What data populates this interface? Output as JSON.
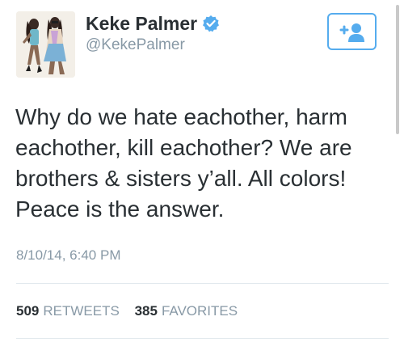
{
  "user": {
    "display_name": "Keke Palmer",
    "handle": "@KekePalmer",
    "verified": true
  },
  "follow_button": {
    "icon": "add-user-icon",
    "color": "#55acee"
  },
  "tweet": {
    "lines": [
      "Why do we hate eachother, harm",
      "eachother, kill eachother? We are",
      "brothers & sisters y’all. All colors!",
      "Peace is the answer."
    ],
    "timestamp": "8/10/14, 6:40 PM"
  },
  "stats": {
    "retweets": {
      "count": "509",
      "label": "RETWEETS"
    },
    "favorites": {
      "count": "385",
      "label": "FAVORITES"
    }
  },
  "colors": {
    "accent": "#55acee",
    "text": "#292f33",
    "muted": "#8899a6",
    "divider": "#e1e8ed"
  }
}
